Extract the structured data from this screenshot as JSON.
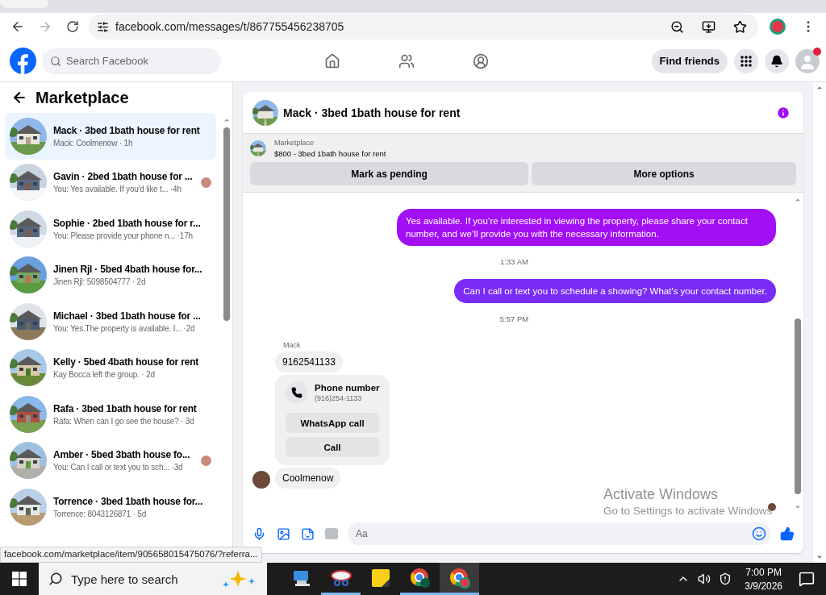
{
  "browser": {
    "url": "facebook.com/messages/t/867755456238705",
    "forward_disabled": true
  },
  "facebook_nav": {
    "search_placeholder": "Search Facebook",
    "find_friends": "Find friends",
    "notification_dot": true
  },
  "sidebar": {
    "title": "Marketplace",
    "conversations": [
      {
        "title": "Mack · 3bed 1bath house for rent",
        "subtitle": "Mack: Coolmenow · 1h",
        "selected": true,
        "seen_avatar": false
      },
      {
        "title": "Gavin · 2bed 1bath house for ...",
        "subtitle": "You: Yes available. If you'd like t...  ·4h",
        "selected": false,
        "seen_avatar": true
      },
      {
        "title": "Sophie · 2bed 1bath house for r...",
        "subtitle": "You: Please provide your phone n... ·17h",
        "selected": false,
        "seen_avatar": false
      },
      {
        "title": "Jinen Rjl · 5bed 4bath house for...",
        "subtitle": "Jinen Rjl: 5098504777 · 2d",
        "selected": false,
        "seen_avatar": false
      },
      {
        "title": "Michael · 3bed 1bath house for ...",
        "subtitle": "You: Yes.The property is available. I... ·2d",
        "selected": false,
        "seen_avatar": false
      },
      {
        "title": "Kelly · 5bed 4bath house for rent",
        "subtitle": "Kay Bocca left the group. · 2d",
        "selected": false,
        "seen_avatar": false
      },
      {
        "title": "Rafa · 3bed 1bath house for rent",
        "subtitle": "Rafa: When can I go see the house? · 3d",
        "selected": false,
        "seen_avatar": false
      },
      {
        "title": "Amber · 5bed 3bath house fo...",
        "subtitle": "You: Can I call or text you to sch... ·3d",
        "selected": false,
        "seen_avatar": true
      },
      {
        "title": "Torrence · 3bed 1bath house for...",
        "subtitle": "Torrence: 8043126871 · 5d",
        "selected": false,
        "seen_avatar": false
      }
    ]
  },
  "chat": {
    "title": "Mack · 3bed 1bath house for rent",
    "listing": {
      "label": "Marketplace",
      "title": "$800 - 3bed 1bath house for rent"
    },
    "actions": [
      "Mark as pending",
      "More options"
    ],
    "messages": [
      {
        "kind": "outgoing",
        "text": "Yes available. If you’re interested in viewing the property, please share your contact number, and we’ll provide you with the necessary information.",
        "color": "#a20ff5"
      },
      {
        "kind": "timestamp",
        "text": "1:33 AM"
      },
      {
        "kind": "outgoing",
        "text": "Can I call or text you to schedule a showing? What's your contact number.",
        "color": "#7a2bf5"
      },
      {
        "kind": "timestamp",
        "text": "5:57 PM"
      },
      {
        "kind": "sender",
        "text": "Mack"
      },
      {
        "kind": "incoming",
        "text": "9162541133",
        "avatar": false
      },
      {
        "kind": "contact",
        "title": "Phone number",
        "number": "(916)254-1133",
        "buttons": [
          "WhatsApp call",
          "Call"
        ]
      },
      {
        "kind": "incoming",
        "text": "Coolmenow",
        "avatar": true
      }
    ],
    "seen_avatar": true,
    "composer_placeholder": "Aa"
  },
  "status_link": "facebook.com/marketplace/item/905658015475076/?referra...",
  "windows_notice": {
    "title": "Activate Windows",
    "text": "Go to Settings to activate Windows"
  },
  "taskbar": {
    "search_placeholder": "Type here to search",
    "apps": [
      {
        "kind": "computer",
        "running": false,
        "active": false
      },
      {
        "kind": "snip",
        "running": true,
        "active": false
      },
      {
        "kind": "notes",
        "running": false,
        "active": false
      },
      {
        "kind": "chrome-k",
        "running": true,
        "active": false
      },
      {
        "kind": "chrome",
        "running": true,
        "active": true
      }
    ],
    "time": "7:00 PM",
    "date": "3/9/2026"
  }
}
